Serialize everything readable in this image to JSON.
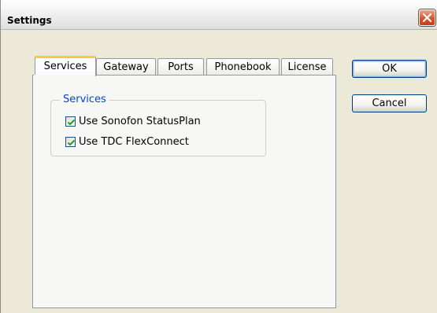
{
  "window": {
    "title": "Settings"
  },
  "tabs": [
    {
      "label": "Services",
      "active": true
    },
    {
      "label": "Gateway",
      "active": false
    },
    {
      "label": "Ports",
      "active": false
    },
    {
      "label": "Phonebook",
      "active": false
    },
    {
      "label": "License",
      "active": false
    }
  ],
  "services_group": {
    "legend": "Services",
    "options": [
      {
        "label": "Use Sonofon StatusPlan",
        "checked": true
      },
      {
        "label": "Use TDC FlexConnect",
        "checked": true
      }
    ]
  },
  "buttons": {
    "ok": "OK",
    "cancel": "Cancel"
  },
  "colors": {
    "group_legend": "#0046d5",
    "active_tab_accent": "#ffc83c",
    "close_button": "#d8552f"
  },
  "icons": {
    "close": "close-icon",
    "check": "check-icon"
  }
}
